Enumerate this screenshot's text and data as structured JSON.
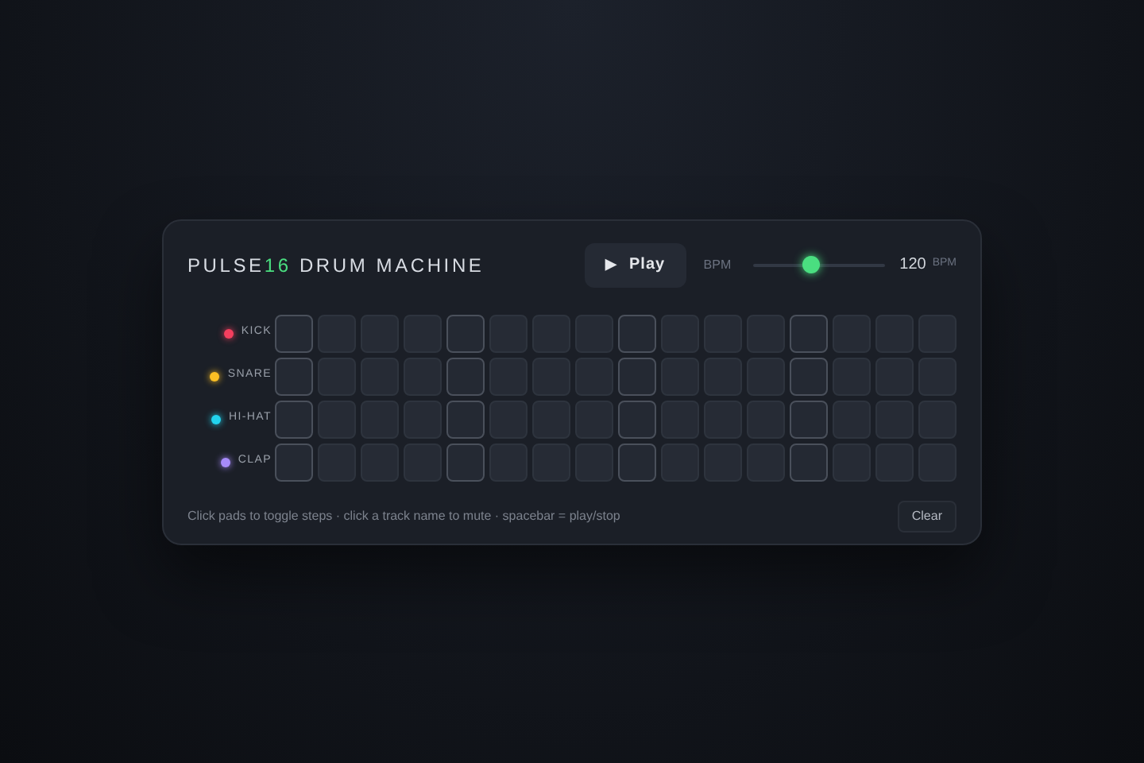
{
  "title": {
    "prefix": "PULSE",
    "accent": "16",
    "suffix": "DRUM MACHINE"
  },
  "play_button": {
    "icon": "▶",
    "label": "Play"
  },
  "tempo": {
    "label": "BPM",
    "level": 0.43,
    "value": "120",
    "unit": "BPM"
  },
  "tracks": [
    {
      "name": "KICK",
      "color": "#f43f5e",
      "steps": [
        false,
        false,
        false,
        false,
        false,
        false,
        false,
        false,
        false,
        false,
        false,
        false,
        false,
        false,
        false,
        false
      ]
    },
    {
      "name": "SNARE",
      "color": "#fbbf24",
      "steps": [
        false,
        false,
        false,
        false,
        false,
        false,
        false,
        false,
        false,
        false,
        false,
        false,
        false,
        false,
        false,
        false
      ]
    },
    {
      "name": "HI-HAT",
      "color": "#22d3ee",
      "steps": [
        false,
        false,
        false,
        false,
        false,
        false,
        false,
        false,
        false,
        false,
        false,
        false,
        false,
        false,
        false,
        false
      ]
    },
    {
      "name": "CLAP",
      "color": "#a78bfa",
      "steps": [
        false,
        false,
        false,
        false,
        false,
        false,
        false,
        false,
        false,
        false,
        false,
        false,
        false,
        false,
        false,
        false
      ]
    }
  ],
  "hint": "Click pads to toggle steps · click a track name to mute · spacebar = play/stop",
  "clear_button": "Clear"
}
